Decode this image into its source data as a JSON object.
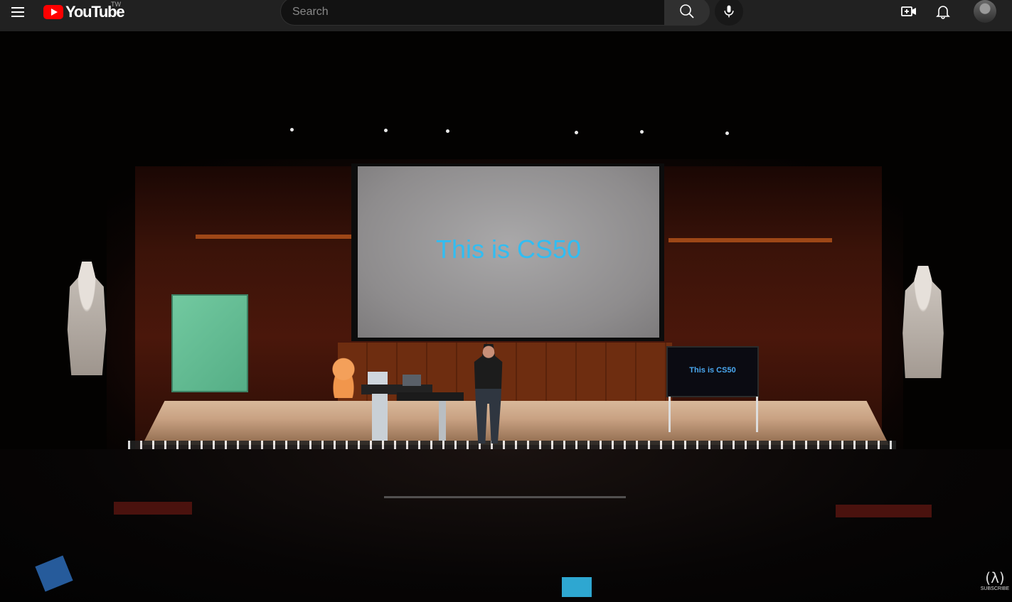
{
  "header": {
    "logo_text": "YouTube",
    "country_code": "TW",
    "search_placeholder": "Search",
    "brand_color": "#ff0000",
    "icons": {
      "menu": "hamburger-menu-icon",
      "search": "search-icon",
      "mic": "microphone-icon",
      "create": "video-camera-plus-icon",
      "notifications": "bell-icon",
      "avatar": "user-avatar"
    }
  },
  "video": {
    "projection_text": "This is CS50",
    "monitor_text": "This is CS50",
    "projection_text_color": "#31bdf2",
    "watermark": {
      "glyph": "(λ)",
      "label": "SUBSCRIBE"
    }
  }
}
